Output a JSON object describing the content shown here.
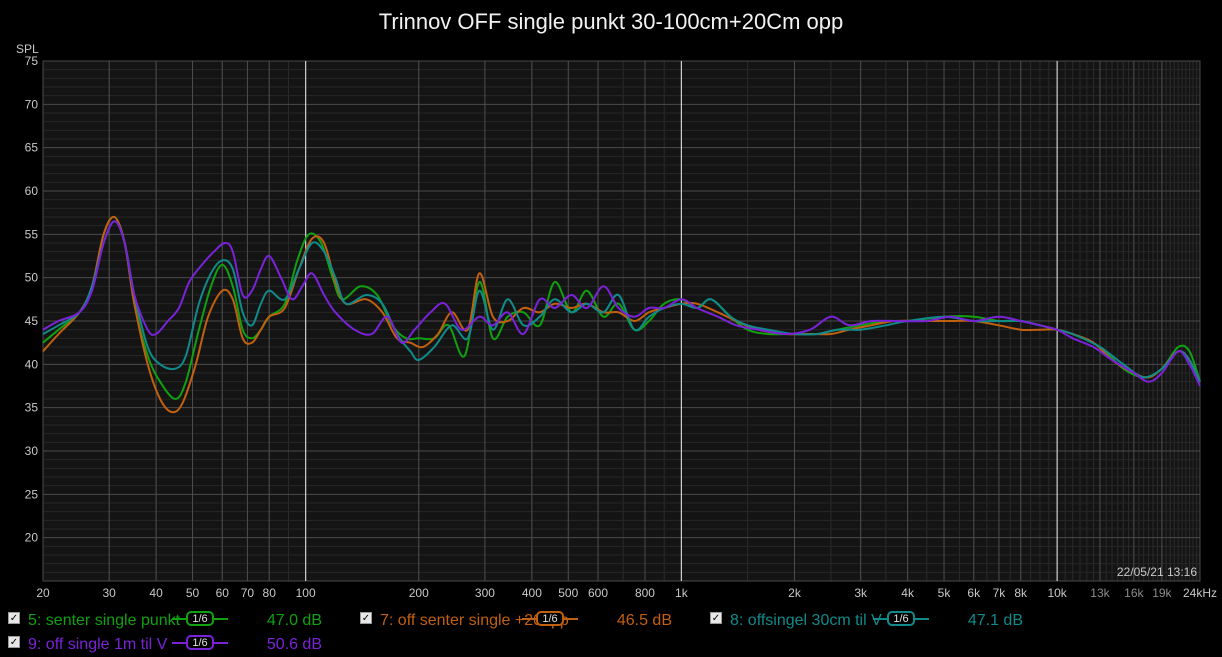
{
  "chart_data": {
    "type": "line",
    "title": "Trinnov OFF single punkt 30-100cm+20Cm opp",
    "ylabel": "SPL",
    "xlabel": "",
    "x_scale": "log",
    "xlim": [
      20,
      24000
    ],
    "ylim": [
      15,
      75
    ],
    "grid": true,
    "y_ticks": [
      "75",
      "70",
      "65",
      "60",
      "55",
      "50",
      "45",
      "40",
      "35",
      "30",
      "25",
      "20"
    ],
    "x_ticks": [
      {
        "v": 20,
        "label": "20"
      },
      {
        "v": 30,
        "label": "30"
      },
      {
        "v": 40,
        "label": "40"
      },
      {
        "v": 50,
        "label": "50"
      },
      {
        "v": 60,
        "label": "60"
      },
      {
        "v": 70,
        "label": "70"
      },
      {
        "v": 80,
        "label": "80"
      },
      {
        "v": 100,
        "label": "100"
      },
      {
        "v": 200,
        "label": "200"
      },
      {
        "v": 300,
        "label": "300"
      },
      {
        "v": 400,
        "label": "400"
      },
      {
        "v": 500,
        "label": "500"
      },
      {
        "v": 600,
        "label": "600"
      },
      {
        "v": 800,
        "label": "800"
      },
      {
        "v": 1000,
        "label": "1k"
      },
      {
        "v": 2000,
        "label": "2k"
      },
      {
        "v": 3000,
        "label": "3k"
      },
      {
        "v": 4000,
        "label": "4k"
      },
      {
        "v": 5000,
        "label": "5k"
      },
      {
        "v": 6000,
        "label": "6k"
      },
      {
        "v": 7000,
        "label": "7k"
      },
      {
        "v": 8000,
        "label": "8k"
      },
      {
        "v": 10000,
        "label": "10k"
      },
      {
        "v": 13000,
        "label": "13k"
      },
      {
        "v": 16000,
        "label": "16k"
      },
      {
        "v": 19000,
        "label": "19k"
      },
      {
        "v": 24000,
        "label": "24kHz"
      }
    ],
    "timestamp": "22/05/21 13:16",
    "series": [
      {
        "name": "5: senter single punkt",
        "color": "#10a010",
        "smoothing": "1/6",
        "level": "47.0 dB",
        "points": [
          [
            20,
            42.5
          ],
          [
            22,
            44
          ],
          [
            25,
            46
          ],
          [
            27,
            49
          ],
          [
            29,
            55
          ],
          [
            31,
            57
          ],
          [
            33,
            54
          ],
          [
            35,
            47
          ],
          [
            38,
            41
          ],
          [
            41,
            38
          ],
          [
            45,
            36
          ],
          [
            48,
            38
          ],
          [
            52,
            44
          ],
          [
            56,
            49
          ],
          [
            60,
            51.5
          ],
          [
            64,
            49
          ],
          [
            68,
            44
          ],
          [
            72,
            43
          ],
          [
            76,
            44
          ],
          [
            80,
            45.5
          ],
          [
            88,
            47
          ],
          [
            95,
            52
          ],
          [
            102,
            55
          ],
          [
            110,
            54
          ],
          [
            118,
            50
          ],
          [
            125,
            47.5
          ],
          [
            140,
            49
          ],
          [
            155,
            48
          ],
          [
            170,
            44.5
          ],
          [
            185,
            43
          ],
          [
            200,
            43
          ],
          [
            220,
            43
          ],
          [
            240,
            44.5
          ],
          [
            265,
            41
          ],
          [
            290,
            49.5
          ],
          [
            315,
            43
          ],
          [
            345,
            45.5
          ],
          [
            380,
            46
          ],
          [
            420,
            44.5
          ],
          [
            460,
            49.5
          ],
          [
            510,
            46
          ],
          [
            560,
            48.5
          ],
          [
            620,
            45.5
          ],
          [
            680,
            47
          ],
          [
            750,
            44
          ],
          [
            820,
            45
          ],
          [
            900,
            47
          ],
          [
            1000,
            47.5
          ],
          [
            1100,
            46.5
          ],
          [
            1200,
            47.5
          ],
          [
            1350,
            45.5
          ],
          [
            1500,
            44
          ],
          [
            1700,
            43.5
          ],
          [
            2000,
            43.5
          ],
          [
            2300,
            43.5
          ],
          [
            2600,
            44
          ],
          [
            3000,
            44.5
          ],
          [
            3500,
            45
          ],
          [
            4000,
            45
          ],
          [
            5000,
            45.5
          ],
          [
            6000,
            45.5
          ],
          [
            7000,
            45
          ],
          [
            8000,
            45
          ],
          [
            9000,
            44.5
          ],
          [
            10000,
            44
          ],
          [
            11000,
            43.5
          ],
          [
            13000,
            42
          ],
          [
            15000,
            39.5
          ],
          [
            17000,
            38.5
          ],
          [
            19000,
            39.5
          ],
          [
            21000,
            42
          ],
          [
            22500,
            41.5
          ],
          [
            24000,
            38
          ]
        ]
      },
      {
        "name": "7: off senter single +20opp",
        "color": "#c06010",
        "smoothing": "1/6",
        "level": "46.5 dB",
        "points": [
          [
            20,
            41.5
          ],
          [
            22,
            43.5
          ],
          [
            25,
            46
          ],
          [
            27,
            49
          ],
          [
            29,
            55
          ],
          [
            31,
            57
          ],
          [
            33,
            54
          ],
          [
            35,
            47
          ],
          [
            38,
            40
          ],
          [
            41,
            36
          ],
          [
            44,
            34.5
          ],
          [
            47,
            35.5
          ],
          [
            51,
            40
          ],
          [
            55,
            45.5
          ],
          [
            60,
            48.5
          ],
          [
            64,
            47.5
          ],
          [
            68,
            43
          ],
          [
            72,
            42.5
          ],
          [
            76,
            44
          ],
          [
            80,
            45.5
          ],
          [
            88,
            46.5
          ],
          [
            96,
            51
          ],
          [
            104,
            54.5
          ],
          [
            112,
            54
          ],
          [
            120,
            49.5
          ],
          [
            128,
            47
          ],
          [
            145,
            47.5
          ],
          [
            160,
            46
          ],
          [
            175,
            43
          ],
          [
            190,
            42.5
          ],
          [
            205,
            42
          ],
          [
            225,
            43.5
          ],
          [
            245,
            46
          ],
          [
            270,
            44
          ],
          [
            290,
            50.5
          ],
          [
            315,
            45.5
          ],
          [
            345,
            45
          ],
          [
            380,
            46.5
          ],
          [
            420,
            46
          ],
          [
            460,
            47
          ],
          [
            510,
            46.5
          ],
          [
            560,
            47
          ],
          [
            620,
            46
          ],
          [
            680,
            46
          ],
          [
            750,
            45
          ],
          [
            820,
            46
          ],
          [
            900,
            46.5
          ],
          [
            1000,
            47
          ],
          [
            1100,
            47
          ],
          [
            1250,
            46
          ],
          [
            1400,
            45
          ],
          [
            1600,
            44
          ],
          [
            1900,
            43.5
          ],
          [
            2200,
            43.5
          ],
          [
            2500,
            43.5
          ],
          [
            2800,
            44
          ],
          [
            3200,
            44.5
          ],
          [
            3700,
            45
          ],
          [
            4500,
            45
          ],
          [
            5200,
            45
          ],
          [
            6000,
            45
          ],
          [
            7000,
            44.5
          ],
          [
            8000,
            44
          ],
          [
            9000,
            44
          ],
          [
            10000,
            44
          ],
          [
            11000,
            43.5
          ],
          [
            12500,
            42.5
          ],
          [
            14000,
            40.5
          ],
          [
            16000,
            39
          ],
          [
            17500,
            38.5
          ],
          [
            19000,
            39.5
          ],
          [
            21000,
            41.5
          ],
          [
            22500,
            40.5
          ],
          [
            24000,
            38
          ]
        ]
      },
      {
        "name": "8: offsingel 30cm til V",
        "color": "#108a8a",
        "smoothing": "1/6",
        "level": "47.1 dB",
        "points": [
          [
            20,
            43.5
          ],
          [
            22,
            44.5
          ],
          [
            25,
            46
          ],
          [
            27,
            49
          ],
          [
            29,
            54
          ],
          [
            31,
            56.5
          ],
          [
            33,
            54
          ],
          [
            35,
            48
          ],
          [
            38,
            42
          ],
          [
            41,
            40
          ],
          [
            45,
            39.5
          ],
          [
            48,
            41
          ],
          [
            52,
            47
          ],
          [
            56,
            50.5
          ],
          [
            60,
            52
          ],
          [
            64,
            51
          ],
          [
            68,
            46
          ],
          [
            72,
            44.5
          ],
          [
            76,
            47
          ],
          [
            80,
            48.5
          ],
          [
            88,
            47.5
          ],
          [
            96,
            51
          ],
          [
            104,
            54
          ],
          [
            112,
            53
          ],
          [
            120,
            50
          ],
          [
            128,
            47
          ],
          [
            145,
            48
          ],
          [
            160,
            47
          ],
          [
            175,
            43.5
          ],
          [
            190,
            41.5
          ],
          [
            200,
            40.5
          ],
          [
            220,
            42
          ],
          [
            245,
            44.5
          ],
          [
            270,
            43
          ],
          [
            290,
            48.5
          ],
          [
            315,
            44
          ],
          [
            345,
            47.5
          ],
          [
            380,
            44.5
          ],
          [
            420,
            45.5
          ],
          [
            460,
            47.5
          ],
          [
            510,
            46
          ],
          [
            560,
            47
          ],
          [
            620,
            46
          ],
          [
            680,
            48
          ],
          [
            750,
            44
          ],
          [
            820,
            45.5
          ],
          [
            900,
            46.5
          ],
          [
            1000,
            47
          ],
          [
            1100,
            46.5
          ],
          [
            1200,
            47.5
          ],
          [
            1350,
            45.5
          ],
          [
            1500,
            44.5
          ],
          [
            1700,
            44
          ],
          [
            2000,
            43.5
          ],
          [
            2300,
            43.5
          ],
          [
            2600,
            44
          ],
          [
            3000,
            44
          ],
          [
            3500,
            44.5
          ],
          [
            4000,
            45
          ],
          [
            5000,
            45.5
          ],
          [
            6000,
            45
          ],
          [
            7000,
            45
          ],
          [
            8000,
            45
          ],
          [
            9000,
            44.5
          ],
          [
            10000,
            44
          ],
          [
            11000,
            43.5
          ],
          [
            13000,
            42
          ],
          [
            15000,
            40
          ],
          [
            17000,
            38.5
          ],
          [
            19000,
            39.5
          ],
          [
            21000,
            41.5
          ],
          [
            22500,
            40.5
          ],
          [
            24000,
            38
          ]
        ]
      },
      {
        "name": "9: off single 1m til V",
        "color": "#7a22d8",
        "smoothing": "1/6",
        "level": "50.6 dB",
        "points": [
          [
            20,
            44
          ],
          [
            22,
            45
          ],
          [
            25,
            46
          ],
          [
            27,
            48.5
          ],
          [
            29,
            54
          ],
          [
            31,
            56.5
          ],
          [
            33,
            54
          ],
          [
            35,
            48
          ],
          [
            38,
            44
          ],
          [
            40,
            43.5
          ],
          [
            43,
            45
          ],
          [
            46,
            46.5
          ],
          [
            49,
            49.5
          ],
          [
            53,
            51.5
          ],
          [
            57,
            53
          ],
          [
            61,
            54
          ],
          [
            64,
            53
          ],
          [
            68,
            48
          ],
          [
            72,
            48.5
          ],
          [
            76,
            51
          ],
          [
            80,
            52.5
          ],
          [
            86,
            50
          ],
          [
            92,
            47.5
          ],
          [
            98,
            49
          ],
          [
            104,
            50.5
          ],
          [
            112,
            48
          ],
          [
            120,
            46
          ],
          [
            135,
            44
          ],
          [
            150,
            43.5
          ],
          [
            165,
            45.5
          ],
          [
            180,
            42.5
          ],
          [
            195,
            44
          ],
          [
            215,
            46
          ],
          [
            235,
            47
          ],
          [
            260,
            44
          ],
          [
            290,
            45.5
          ],
          [
            315,
            44.5
          ],
          [
            345,
            46
          ],
          [
            380,
            43.5
          ],
          [
            420,
            47.5
          ],
          [
            460,
            46.5
          ],
          [
            510,
            48
          ],
          [
            560,
            46.5
          ],
          [
            620,
            49
          ],
          [
            680,
            46.5
          ],
          [
            750,
            45.5
          ],
          [
            820,
            46.5
          ],
          [
            900,
            46.5
          ],
          [
            1000,
            47.5
          ],
          [
            1100,
            46.5
          ],
          [
            1250,
            45.5
          ],
          [
            1400,
            44.5
          ],
          [
            1600,
            44
          ],
          [
            1900,
            43.5
          ],
          [
            2200,
            44
          ],
          [
            2500,
            45.5
          ],
          [
            2800,
            44.5
          ],
          [
            3200,
            45
          ],
          [
            3700,
            45
          ],
          [
            4500,
            45
          ],
          [
            5200,
            45.5
          ],
          [
            6000,
            45
          ],
          [
            7000,
            45.5
          ],
          [
            8000,
            45
          ],
          [
            9000,
            44.5
          ],
          [
            10000,
            44
          ],
          [
            11000,
            43
          ],
          [
            12500,
            42
          ],
          [
            14000,
            40.5
          ],
          [
            16000,
            39
          ],
          [
            17500,
            38
          ],
          [
            19000,
            39
          ],
          [
            21000,
            41.5
          ],
          [
            22500,
            40
          ],
          [
            24000,
            37.5
          ]
        ]
      }
    ]
  }
}
